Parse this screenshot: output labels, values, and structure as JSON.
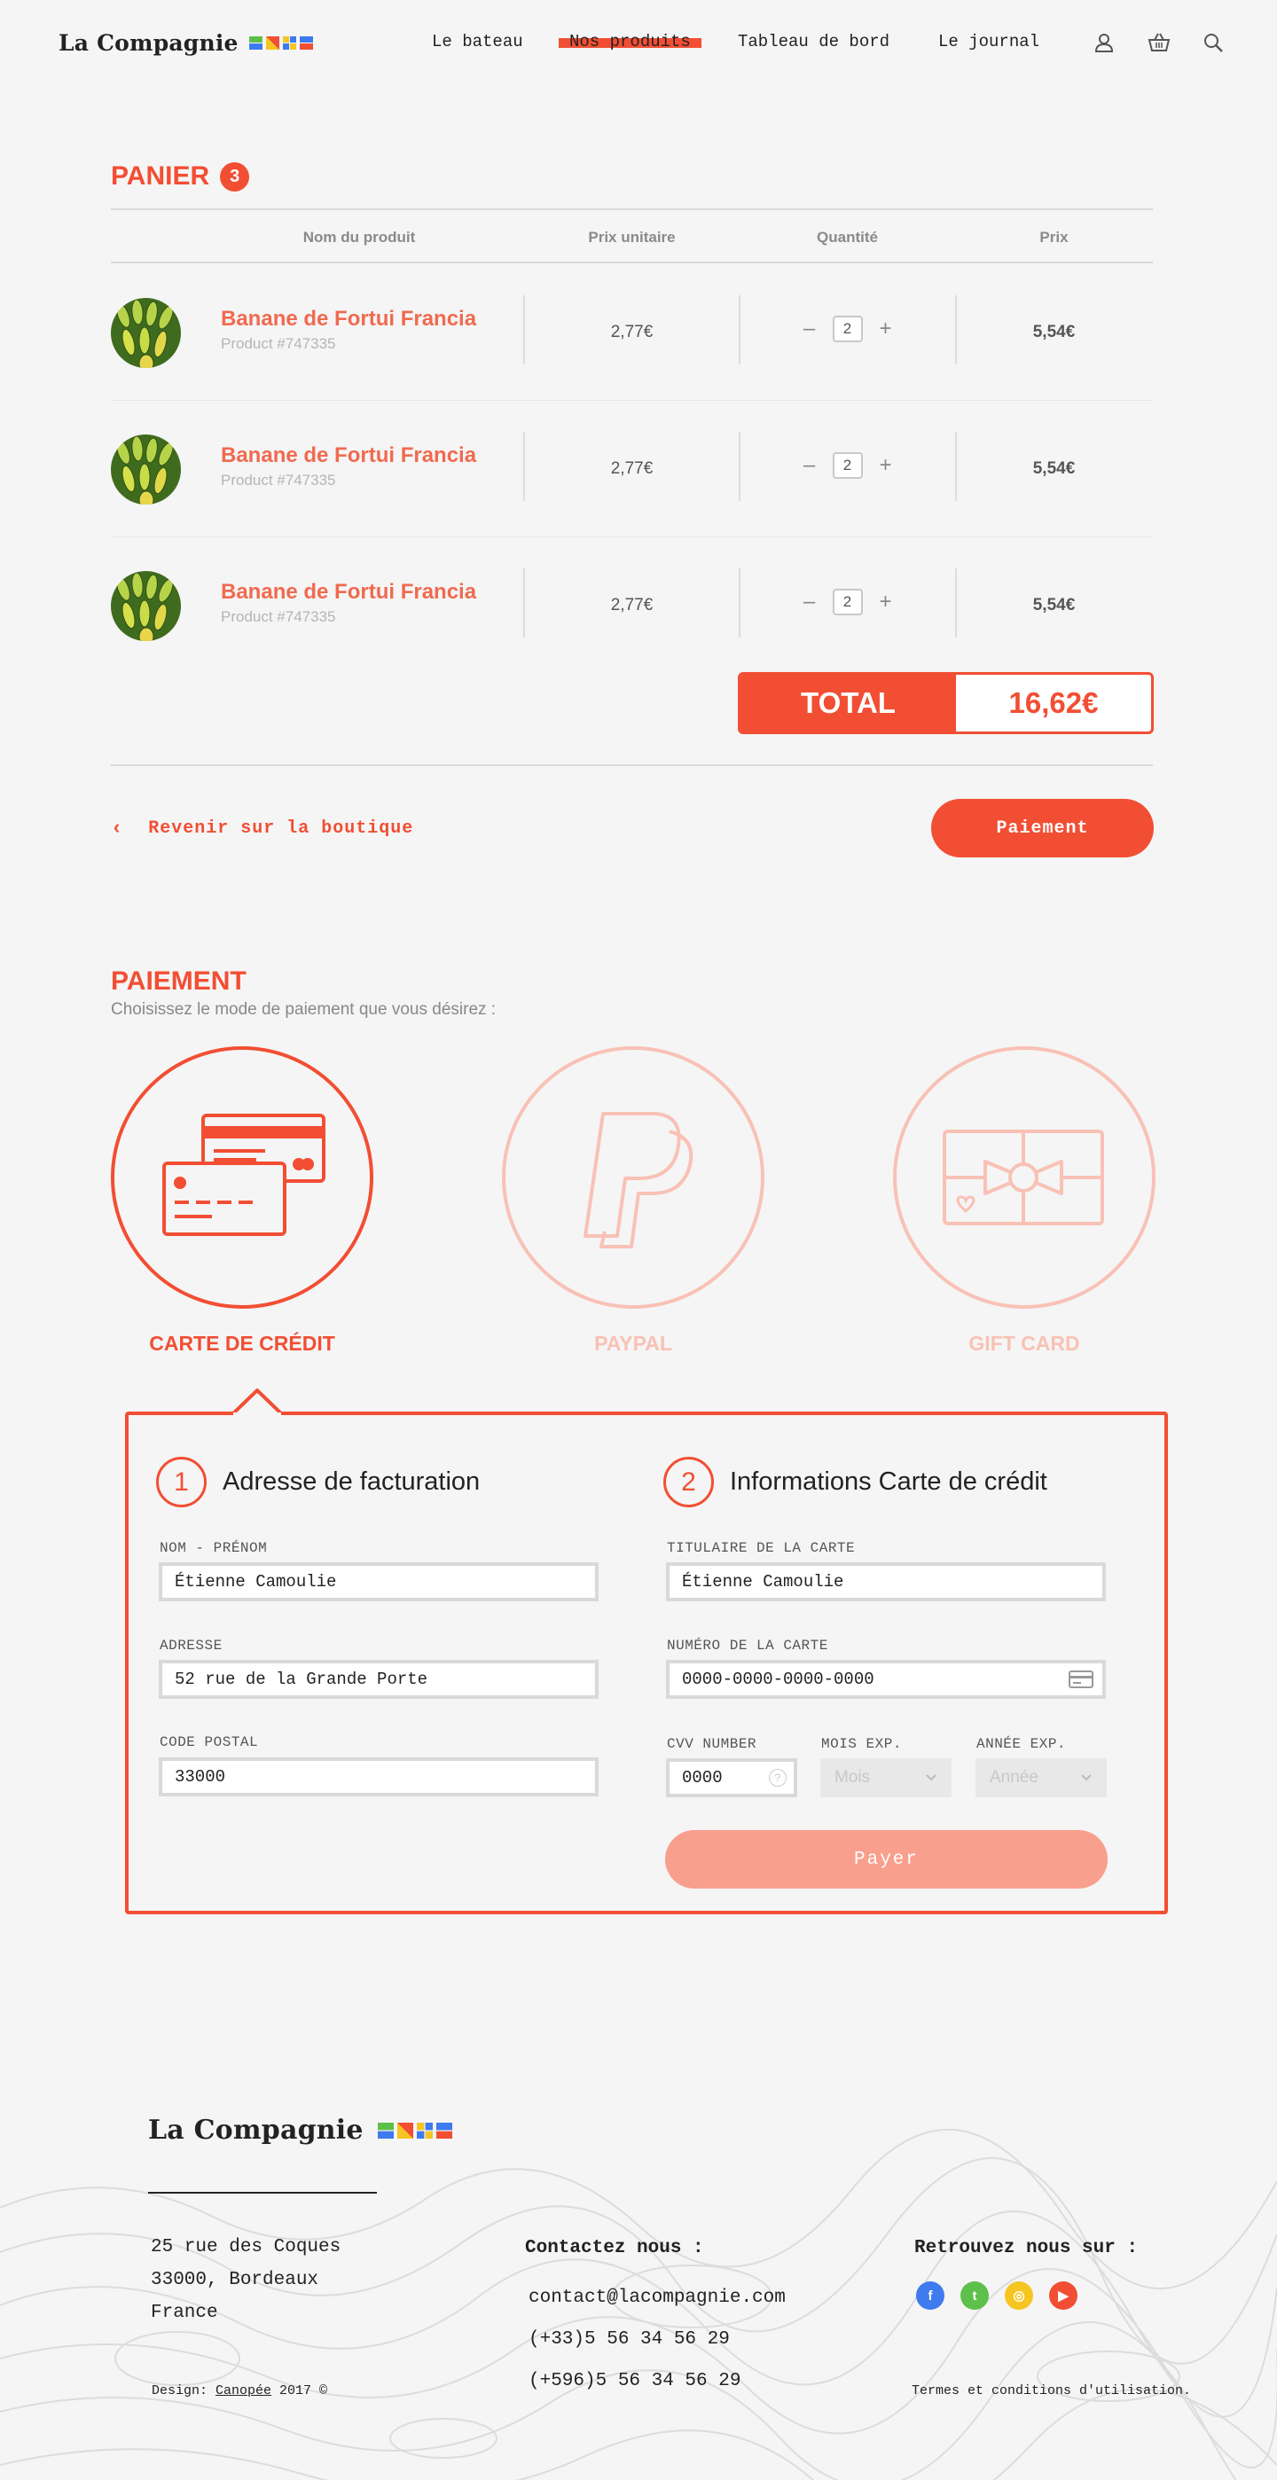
{
  "brand": {
    "name": "La Compagnie",
    "flag_colors": [
      "#3d7bef",
      "#5dc04a",
      "#f5c522",
      "#f24e33"
    ]
  },
  "nav": {
    "items": [
      "Le bateau",
      "Nos produits",
      "Tableau de bord",
      "Le journal"
    ],
    "active": "Nos produits",
    "icons": [
      "user-icon",
      "basket-icon",
      "search-icon"
    ]
  },
  "cart": {
    "title": "PANIER",
    "count": "3",
    "columns": [
      "Nom du produit",
      "Prix unitaire",
      "Quantité",
      "Prix"
    ],
    "items": [
      {
        "name": "Banane de Fortui Francia",
        "id": "Product #747335",
        "unit_price": "2,77€",
        "qty": "2",
        "price": "5,54€"
      },
      {
        "name": "Banane de Fortui Francia",
        "id": "Product #747335",
        "unit_price": "2,77€",
        "qty": "2",
        "price": "5,54€"
      },
      {
        "name": "Banane de Fortui Francia",
        "id": "Product #747335",
        "unit_price": "2,77€",
        "qty": "2",
        "price": "5,54€"
      }
    ],
    "total_label": "TOTAL",
    "total_value": "16,62€",
    "back_label": "Revenir sur la boutique",
    "checkout_label": "Paiement"
  },
  "payment": {
    "title": "PAIEMENT",
    "subtitle": "Choisissez le mode de paiement que vous désirez :",
    "methods": [
      {
        "label": "CARTE DE CRÉDIT",
        "selected": true
      },
      {
        "label": "PAYPAL",
        "selected": false
      },
      {
        "label": "GIFT CARD",
        "selected": false
      }
    ],
    "billing": {
      "step": "1",
      "title": "Adresse de facturation",
      "name_label": "NOM - PRÉNOM",
      "name_value": "Étienne Camoulie",
      "address_label": "ADRESSE",
      "address_value": "52 rue de la Grande Porte",
      "zip_label": "CODE POSTAL",
      "zip_value": "33000"
    },
    "card": {
      "step": "2",
      "title": "Informations Carte de crédit",
      "holder_label": "TITULAIRE DE LA CARTE",
      "holder_value": "Étienne Camoulie",
      "number_label": "NUMÉRO DE LA CARTE",
      "number_value": "0000-0000-0000-0000",
      "cvv_label": "CVV NUMBER",
      "cvv_value": "0000",
      "month_label": "MOIS EXP.",
      "month_placeholder": "Mois",
      "year_label": "ANNÉE EXP.",
      "year_placeholder": "Année",
      "pay_label": "Payer"
    }
  },
  "footer": {
    "address": [
      "25 rue des Coques",
      "33000, Bordeaux",
      "France"
    ],
    "contact_title": "Contactez nous :",
    "contact": [
      "contact@lacompagnie.com",
      "(+33)5 56 34 56 29",
      "(+596)5 56 34 56 29"
    ],
    "social_title": "Retrouvez nous sur :",
    "social": [
      {
        "icon": "facebook-icon",
        "glyph": "f",
        "color": "#3d7bef"
      },
      {
        "icon": "twitter-icon",
        "glyph": "t",
        "color": "#5dc04a"
      },
      {
        "icon": "instagram-icon",
        "glyph": "◎",
        "color": "#f5c522"
      },
      {
        "icon": "youtube-icon",
        "glyph": "▶",
        "color": "#f24e33"
      }
    ],
    "credit_prefix": "Design: ",
    "credit_link": "Canopée",
    "credit_suffix": " 2017 ©",
    "terms": "Termes et conditions d'utilisation."
  }
}
